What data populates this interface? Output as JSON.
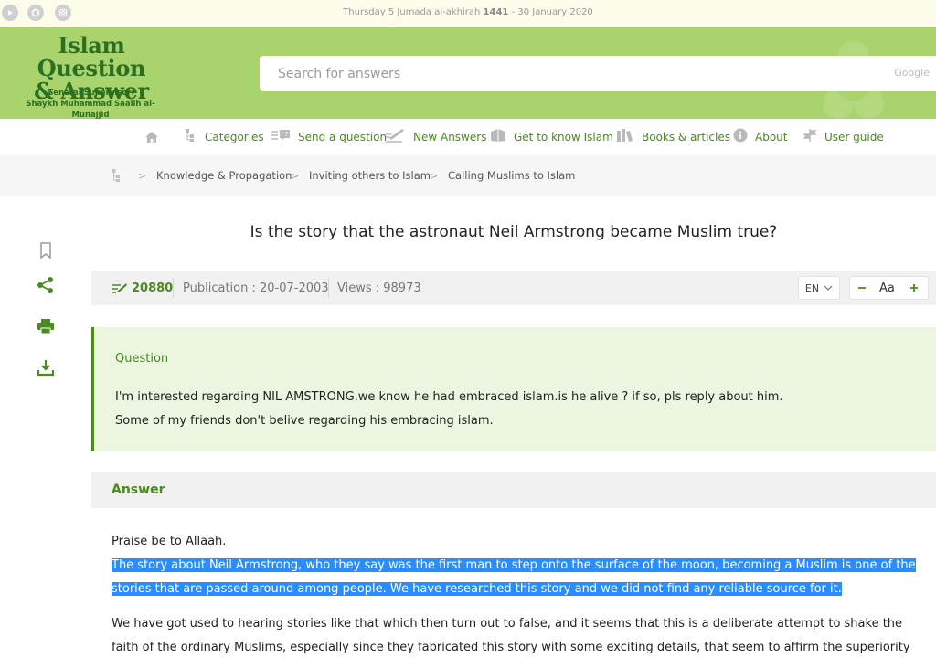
{
  "topbar": {
    "date_prefix": "Thursday 5 Jumada al-akhirah",
    "date_year": "1441",
    "date_suffix": "- 30 January 2020",
    "social_icons": [
      "youtube-icon",
      "podcast-icon",
      "instagram-icon"
    ]
  },
  "header": {
    "title_line1": "Islam Question",
    "title_line2": "& Answer",
    "supervisor_label": "General Supervisor:",
    "supervisor_name": "Shaykh Muhammad Saalih al-Munajjid",
    "search_placeholder": "Search for answers",
    "search_brand": "Google"
  },
  "nav": {
    "items": [
      {
        "label": "Categories",
        "icon": "categories-icon"
      },
      {
        "label": "Send a question",
        "icon": "send-question-icon"
      },
      {
        "label": "New Answers",
        "icon": "new-answers-icon"
      },
      {
        "label": "Get to know Islam",
        "icon": "know-islam-icon"
      },
      {
        "label": "Books & articles",
        "icon": "books-icon"
      },
      {
        "label": "About",
        "icon": "info-icon"
      },
      {
        "label": "User guide",
        "icon": "user-guide-icon"
      }
    ]
  },
  "breadcrumb": {
    "items": [
      "Knowledge & Propagation",
      "Inviting others to Islam",
      "Calling Muslims to Islam"
    ],
    "separator": ">"
  },
  "question": {
    "title": "Is the story that the astronaut Neil Armstrong became Muslim true?",
    "number": "20880",
    "publication": "Publication : 20-07-2003",
    "views": "Views : 98973",
    "lang": "EN",
    "font_label": "Aa",
    "label": "Question",
    "line1": "I'm interested regarding NIL AMSTRONG.we know he had embraced islam.is he alive ? if so, pls reply about him.",
    "line2": "Some of my friends don't belive regarding his embracing islam."
  },
  "answer": {
    "label": "Answer",
    "praise": "Praise be to Allaah.",
    "highlighted": "The story about Neil Armstrong, who they say was the first man to step onto the surface of the moon, becoming a Muslim is one of the stories that are passed around among people. We have researched this story and we did not find any reliable source for it.",
    "para2": "We have got used to hearing stories like that which then turn out to false, and it seems that this is a deliberate attempt to shake the faith of the ordinary Muslims, especially since they fabricated this story with some exciting details, that seem to affirm the superiority of this"
  },
  "colors": {
    "brand_green": "#4a8a1e",
    "header_green": "#a9d36d",
    "question_bg": "#ebf5df",
    "selection_blue": "#2a8cff"
  }
}
